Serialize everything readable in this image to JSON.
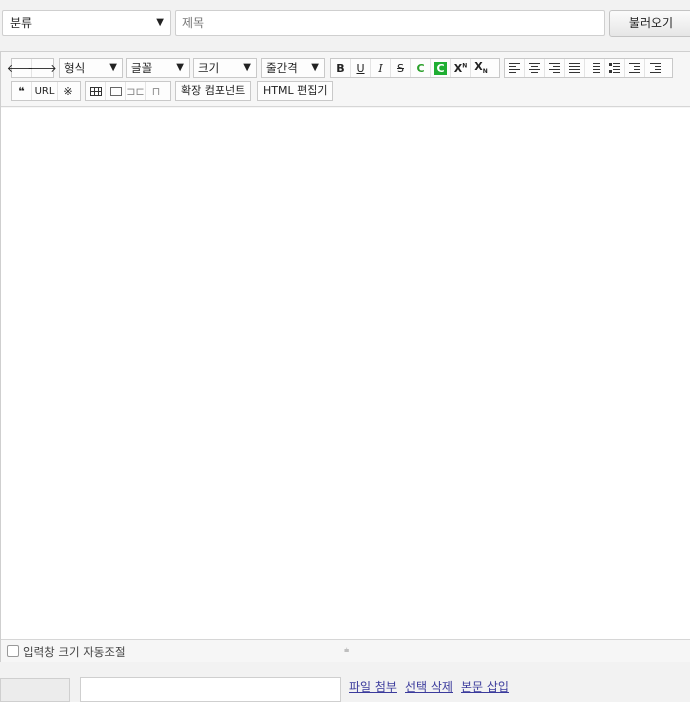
{
  "header": {
    "category_select": {
      "value": "분류"
    },
    "title_input": {
      "placeholder": "제목",
      "value": ""
    },
    "load_button": "불러오기"
  },
  "toolbar": {
    "row1": {
      "undo_icon": "arrow-left-icon",
      "redo_icon": "arrow-right-icon",
      "format_dropdown": "형식",
      "font_dropdown": "글꼴",
      "size_dropdown": "크기",
      "line_height_dropdown": "줄간격",
      "bold": "B",
      "underline": "U",
      "italic": "I",
      "strike": "S",
      "font_color": "C",
      "bg_color": "C",
      "superscript": "X",
      "superscript_mark": "N",
      "subscript": "X",
      "subscript_mark": "N"
    },
    "row2": {
      "quote": "❝",
      "url": "URL",
      "special_char": "※",
      "extension_component": "확장 컴포넌트",
      "html_editor": "HTML 편집기"
    },
    "colors": {
      "font_color": "#2ca02c",
      "bg_color": "#1fae32"
    }
  },
  "editor": {
    "autosize_label": "입력창 크기 자동조절",
    "resize_glyph": "⩧"
  },
  "footer": {
    "attach_file": "파일 첨부",
    "delete_selected": "선택 삭제",
    "insert_into_body": "본문 삽입"
  }
}
